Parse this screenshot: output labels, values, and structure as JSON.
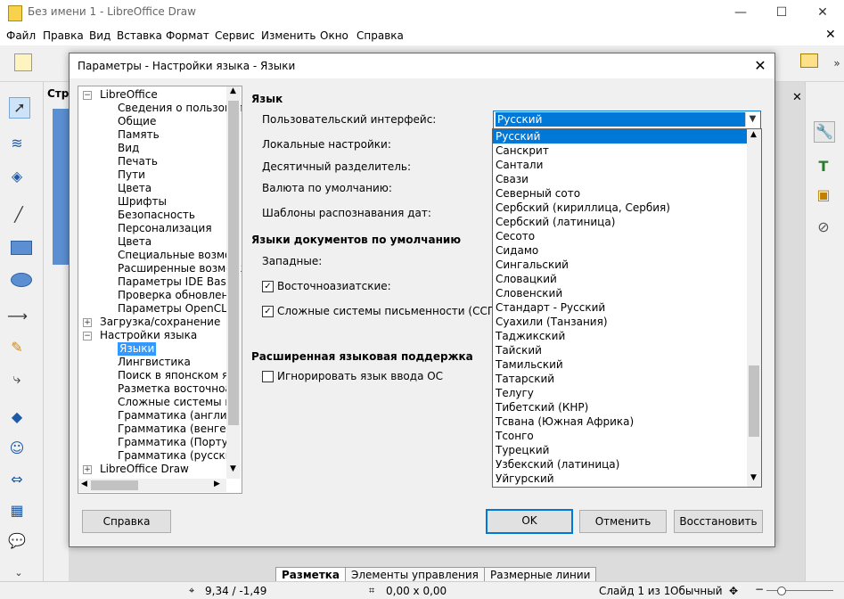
{
  "app": {
    "title": "Без имени 1 - LibreOffice Draw",
    "window_controls": {
      "minimize": "—",
      "maximize": "☐",
      "close": "✕"
    }
  },
  "menubar": {
    "items": [
      {
        "label": "Файл"
      },
      {
        "label": "Правка"
      },
      {
        "label": "Вид"
      },
      {
        "label": "Вставка"
      },
      {
        "label": "Формат"
      },
      {
        "label": "Сервис"
      },
      {
        "label": "Изменить"
      },
      {
        "label": "Окно"
      },
      {
        "label": "Справка"
      }
    ]
  },
  "workspace": {
    "sidebar_title": "Стра",
    "sheet_tabs": [
      "Разметка",
      "Элементы управления",
      "Размерные линии"
    ]
  },
  "statusbar": {
    "position": "9,34 / -1,49",
    "size": "0,00 x 0,00",
    "slide": "Слайд 1 из 1",
    "layout": "Обычный"
  },
  "dialog": {
    "title": "Параметры - Настройки языка - Языки",
    "tree": {
      "items": [
        {
          "label": "LibreOffice",
          "level": 0,
          "expander": "−"
        },
        {
          "label": "Сведения о пользовате",
          "level": 1
        },
        {
          "label": "Общие",
          "level": 1
        },
        {
          "label": "Память",
          "level": 1
        },
        {
          "label": "Вид",
          "level": 1
        },
        {
          "label": "Печать",
          "level": 1
        },
        {
          "label": "Пути",
          "level": 1
        },
        {
          "label": "Цвета",
          "level": 1
        },
        {
          "label": "Шрифты",
          "level": 1
        },
        {
          "label": "Безопасность",
          "level": 1
        },
        {
          "label": "Персонализация",
          "level": 1
        },
        {
          "label": "Цвета",
          "level": 1
        },
        {
          "label": "Специальные возмож",
          "level": 1
        },
        {
          "label": "Расширенные возмож",
          "level": 1
        },
        {
          "label": "Параметры IDE Basic",
          "level": 1
        },
        {
          "label": "Проверка обновлени",
          "level": 1
        },
        {
          "label": "Параметры OpenCL",
          "level": 1
        },
        {
          "label": "Загрузка/сохранение",
          "level": 0,
          "expander": "+"
        },
        {
          "label": "Настройки языка",
          "level": 0,
          "expander": "−"
        },
        {
          "label": "Языки",
          "level": 1,
          "selected": true
        },
        {
          "label": "Лингвистика",
          "level": 1
        },
        {
          "label": "Поиск в японском я",
          "level": 1
        },
        {
          "label": "Разметка восточноаз",
          "level": 1
        },
        {
          "label": "Сложные системы пи",
          "level": 1
        },
        {
          "label": "Грамматика (английс",
          "level": 1
        },
        {
          "label": "Грамматика (венгерс",
          "level": 1
        },
        {
          "label": "Грамматика (Португа",
          "level": 1
        },
        {
          "label": "Грамматика (русский",
          "level": 1
        },
        {
          "label": "LibreOffice Draw",
          "level": 0,
          "expander": "+"
        }
      ]
    },
    "language_section": {
      "heading": "Язык",
      "ui_label": "Пользовательский интерфейс:",
      "locale_label": "Локальные настройки:",
      "decimal_label": "Десятичный разделитель:",
      "currency_label": "Валюта по умолчанию:",
      "date_patterns_label": "Шаблоны распознавания дат:",
      "ui_value": "Русский"
    },
    "doc_lang_section": {
      "heading": "Языки документов по умолчанию",
      "western_label": "Западные:",
      "asian_label": "Восточноазиатские:",
      "asian_checked": true,
      "ctl_label": "Сложные системы письменности (ССП):",
      "ctl_checked": true
    },
    "ext_section": {
      "heading": "Расширенная языковая поддержка",
      "ignore_label": "Игнорировать язык ввода ОС",
      "ignore_checked": false
    },
    "dropdown_options": [
      "Русский",
      "Санскрит",
      "Сантали",
      "Свази",
      "Северный сото",
      "Сербский (кириллица, Сербия)",
      "Сербский (латиница)",
      "Сесото",
      "Сидамо",
      "Сингальский",
      "Словацкий",
      "Словенский",
      "Стандарт - Русский",
      "Суахили (Танзания)",
      "Таджикский",
      "Тайский",
      "Тамильский",
      "Татарский",
      "Телугу",
      "Тибетский (КНР)",
      "Тсвана (Южная Африка)",
      "Тсонго",
      "Турецкий",
      "Узбекский (латиница)",
      "Уйгурский"
    ],
    "buttons": {
      "help": "Справка",
      "ok": "OK",
      "cancel": "Отменить",
      "reset": "Восстановить"
    }
  },
  "colors": {
    "accent": "#0078d7",
    "selection": "#3399ff"
  }
}
